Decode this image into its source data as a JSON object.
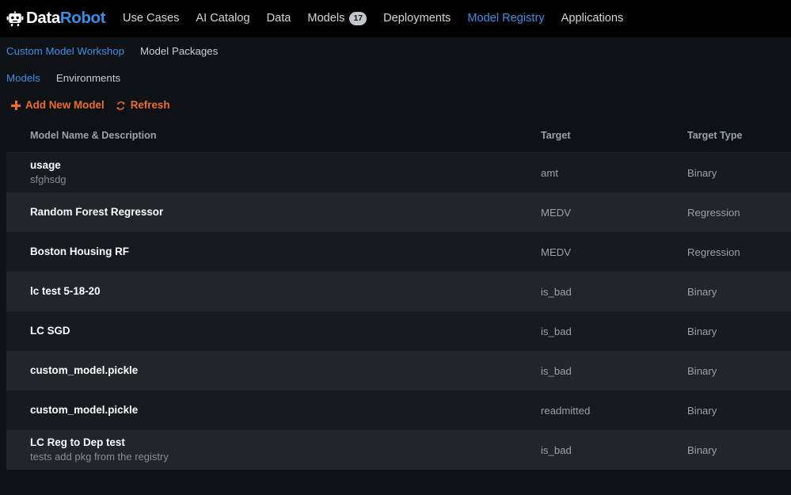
{
  "brand": {
    "icon": "robot-head-icon",
    "name_first": "Data",
    "name_second": "Robot",
    "accent_blue": "#3b8fe3"
  },
  "topnav": {
    "items": [
      {
        "label": "Use Cases",
        "active": false,
        "badge": null
      },
      {
        "label": "AI Catalog",
        "active": false,
        "badge": null
      },
      {
        "label": "Data",
        "active": false,
        "badge": null
      },
      {
        "label": "Models",
        "active": false,
        "badge": "17"
      },
      {
        "label": "Deployments",
        "active": false,
        "badge": null
      },
      {
        "label": "Model Registry",
        "active": true,
        "badge": null
      },
      {
        "label": "Applications",
        "active": false,
        "badge": null
      }
    ]
  },
  "breadcrumbs_primary": [
    {
      "label": "Custom Model Workshop",
      "active": true
    },
    {
      "label": "Model Packages",
      "active": false
    }
  ],
  "breadcrumbs_secondary": [
    {
      "label": "Models",
      "active": true
    },
    {
      "label": "Environments",
      "active": false
    }
  ],
  "actions": {
    "add_label": "Add New Model",
    "add_icon": "plus-icon",
    "refresh_label": "Refresh",
    "refresh_icon": "refresh-icon",
    "accent_orange": "#f06c22"
  },
  "table": {
    "columns": [
      "Model Name & Description",
      "Target",
      "Target Type"
    ],
    "rows": [
      {
        "name": "usage",
        "description": "sfghsdg",
        "target": "amt",
        "target_type": "Binary"
      },
      {
        "name": "Random Forest Regressor",
        "description": "",
        "target": "MEDV",
        "target_type": "Regression"
      },
      {
        "name": "Boston Housing RF",
        "description": "",
        "target": "MEDV",
        "target_type": "Regression"
      },
      {
        "name": "lc test 5-18-20",
        "description": "",
        "target": "is_bad",
        "target_type": "Binary"
      },
      {
        "name": "LC SGD",
        "description": "",
        "target": "is_bad",
        "target_type": "Binary"
      },
      {
        "name": "custom_model.pickle",
        "description": "",
        "target": "is_bad",
        "target_type": "Binary"
      },
      {
        "name": "custom_model.pickle",
        "description": "",
        "target": "readmitted",
        "target_type": "Binary"
      },
      {
        "name": "LC Reg to Dep test",
        "description": "tests add pkg from the registry",
        "target": "is_bad",
        "target_type": "Binary"
      }
    ]
  }
}
